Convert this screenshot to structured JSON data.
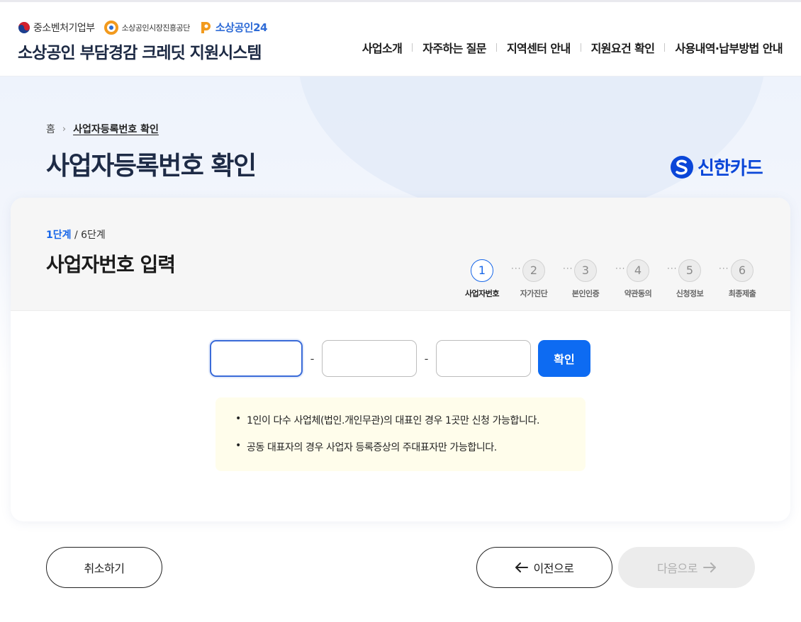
{
  "header": {
    "logos": {
      "ministry": "중소벤처기업부",
      "agency": "소상공인시장진흥공단",
      "portal": "소상공인24"
    },
    "site_title": "소상공인 부담경감 크레딧 지원시스템",
    "nav": [
      "사업소개",
      "자주하는 질문",
      "지역센터 안내",
      "지원요건 확인",
      "사용내역·납부방법 안내"
    ]
  },
  "breadcrumb": {
    "home": "홈",
    "current": "사업자등록번호 확인"
  },
  "page_title": "사업자등록번호 확인",
  "partner": {
    "name": "신한카드",
    "brand_color": "#0a46d8"
  },
  "form": {
    "step_current": "1단계",
    "step_total": "/ 6단계",
    "title": "사업자번호 입력",
    "steps": [
      {
        "number": "1",
        "label": "사업자번호",
        "active": true
      },
      {
        "number": "2",
        "label": "자가진단",
        "active": false
      },
      {
        "number": "3",
        "label": "본인인증",
        "active": false
      },
      {
        "number": "4",
        "label": "약관동의",
        "active": false
      },
      {
        "number": "5",
        "label": "신청정보",
        "active": false
      },
      {
        "number": "6",
        "label": "최종제출",
        "active": false
      }
    ],
    "step_dots": "···",
    "inputs": {
      "part1": "",
      "part2": "",
      "part3": "",
      "separator": "-"
    },
    "confirm_label": "확인",
    "notices": [
      "1인이 다수 사업체(법인.개인무관)의 대표인 경우 1곳만 신청 가능합니다.",
      "공동 대표자의 경우 사업자 등록증상의 주대표자만 가능합니다."
    ]
  },
  "actions": {
    "cancel": "취소하기",
    "prev": "이전으로",
    "next": "다음으로"
  },
  "colors": {
    "accent": "#0d6bf2",
    "title_navy": "#1e2b46",
    "notice_bg": "#fffdeb"
  }
}
